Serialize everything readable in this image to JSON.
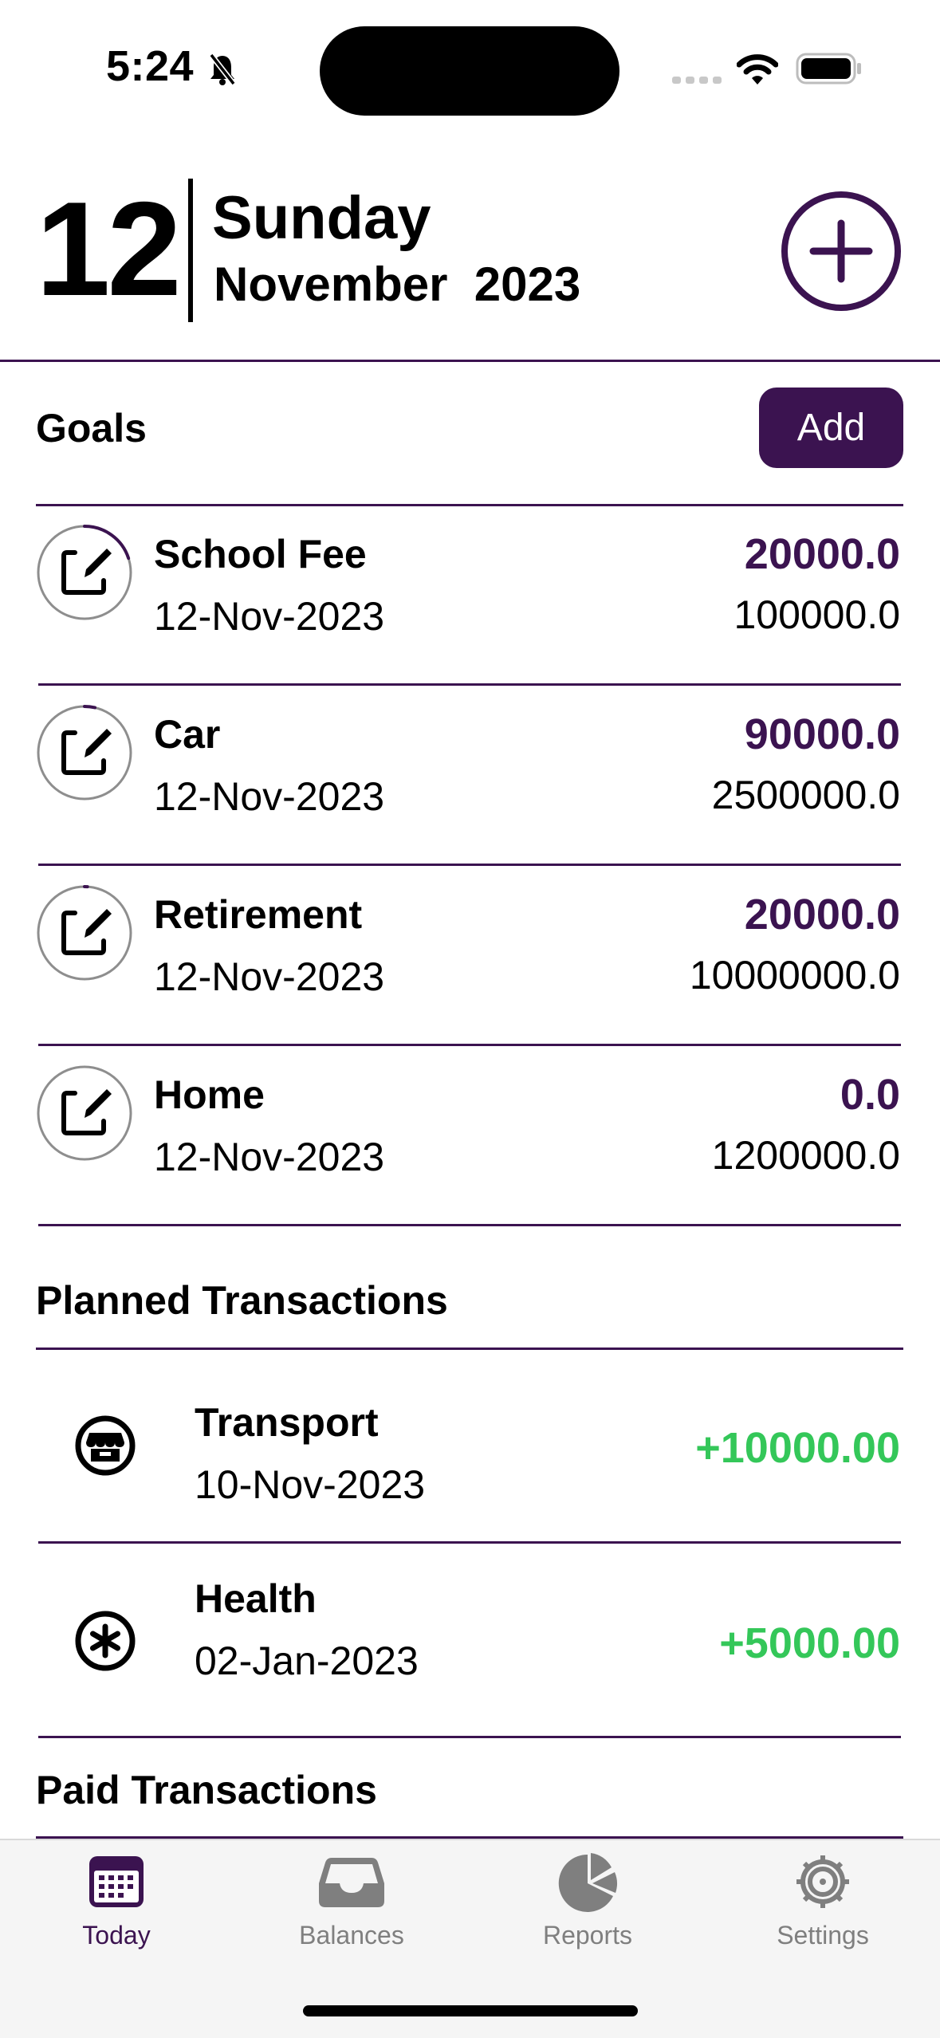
{
  "status_bar": {
    "time": "5:24"
  },
  "header": {
    "day": "12",
    "weekday": "Sunday",
    "month_year": "November  2023"
  },
  "goals": {
    "title": "Goals",
    "add_label": "Add",
    "items": [
      {
        "name": "School Fee",
        "date": "12-Nov-2023",
        "saved": "20000.0",
        "target": "100000.0",
        "progress": 0.2
      },
      {
        "name": "Car",
        "date": "12-Nov-2023",
        "saved": "90000.0",
        "target": "2500000.0",
        "progress": 0.036
      },
      {
        "name": "Retirement",
        "date": "12-Nov-2023",
        "saved": "20000.0",
        "target": "10000000.0",
        "progress": 0.002
      },
      {
        "name": "Home",
        "date": "12-Nov-2023",
        "saved": "0.0",
        "target": "1200000.0",
        "progress": 0
      }
    ]
  },
  "planned": {
    "title": "Planned Transactions",
    "items": [
      {
        "name": "Transport",
        "date": "10-Nov-2023",
        "amount": "+10000.00",
        "icon": "store-icon"
      },
      {
        "name": "Health",
        "date": "02-Jan-2023",
        "amount": "+5000.00",
        "icon": "asterisk-icon"
      }
    ]
  },
  "paid": {
    "title": "Paid Transactions"
  },
  "tabs": [
    {
      "label": "Today",
      "icon": "calendar-icon",
      "active": true
    },
    {
      "label": "Balances",
      "icon": "tray-icon",
      "active": false
    },
    {
      "label": "Reports",
      "icon": "pie-chart-icon",
      "active": false
    },
    {
      "label": "Settings",
      "icon": "gear-icon",
      "active": false
    }
  ],
  "colors": {
    "accent": "#3b1350",
    "positive": "#34c759",
    "tab_inactive": "#7f7f7f"
  }
}
